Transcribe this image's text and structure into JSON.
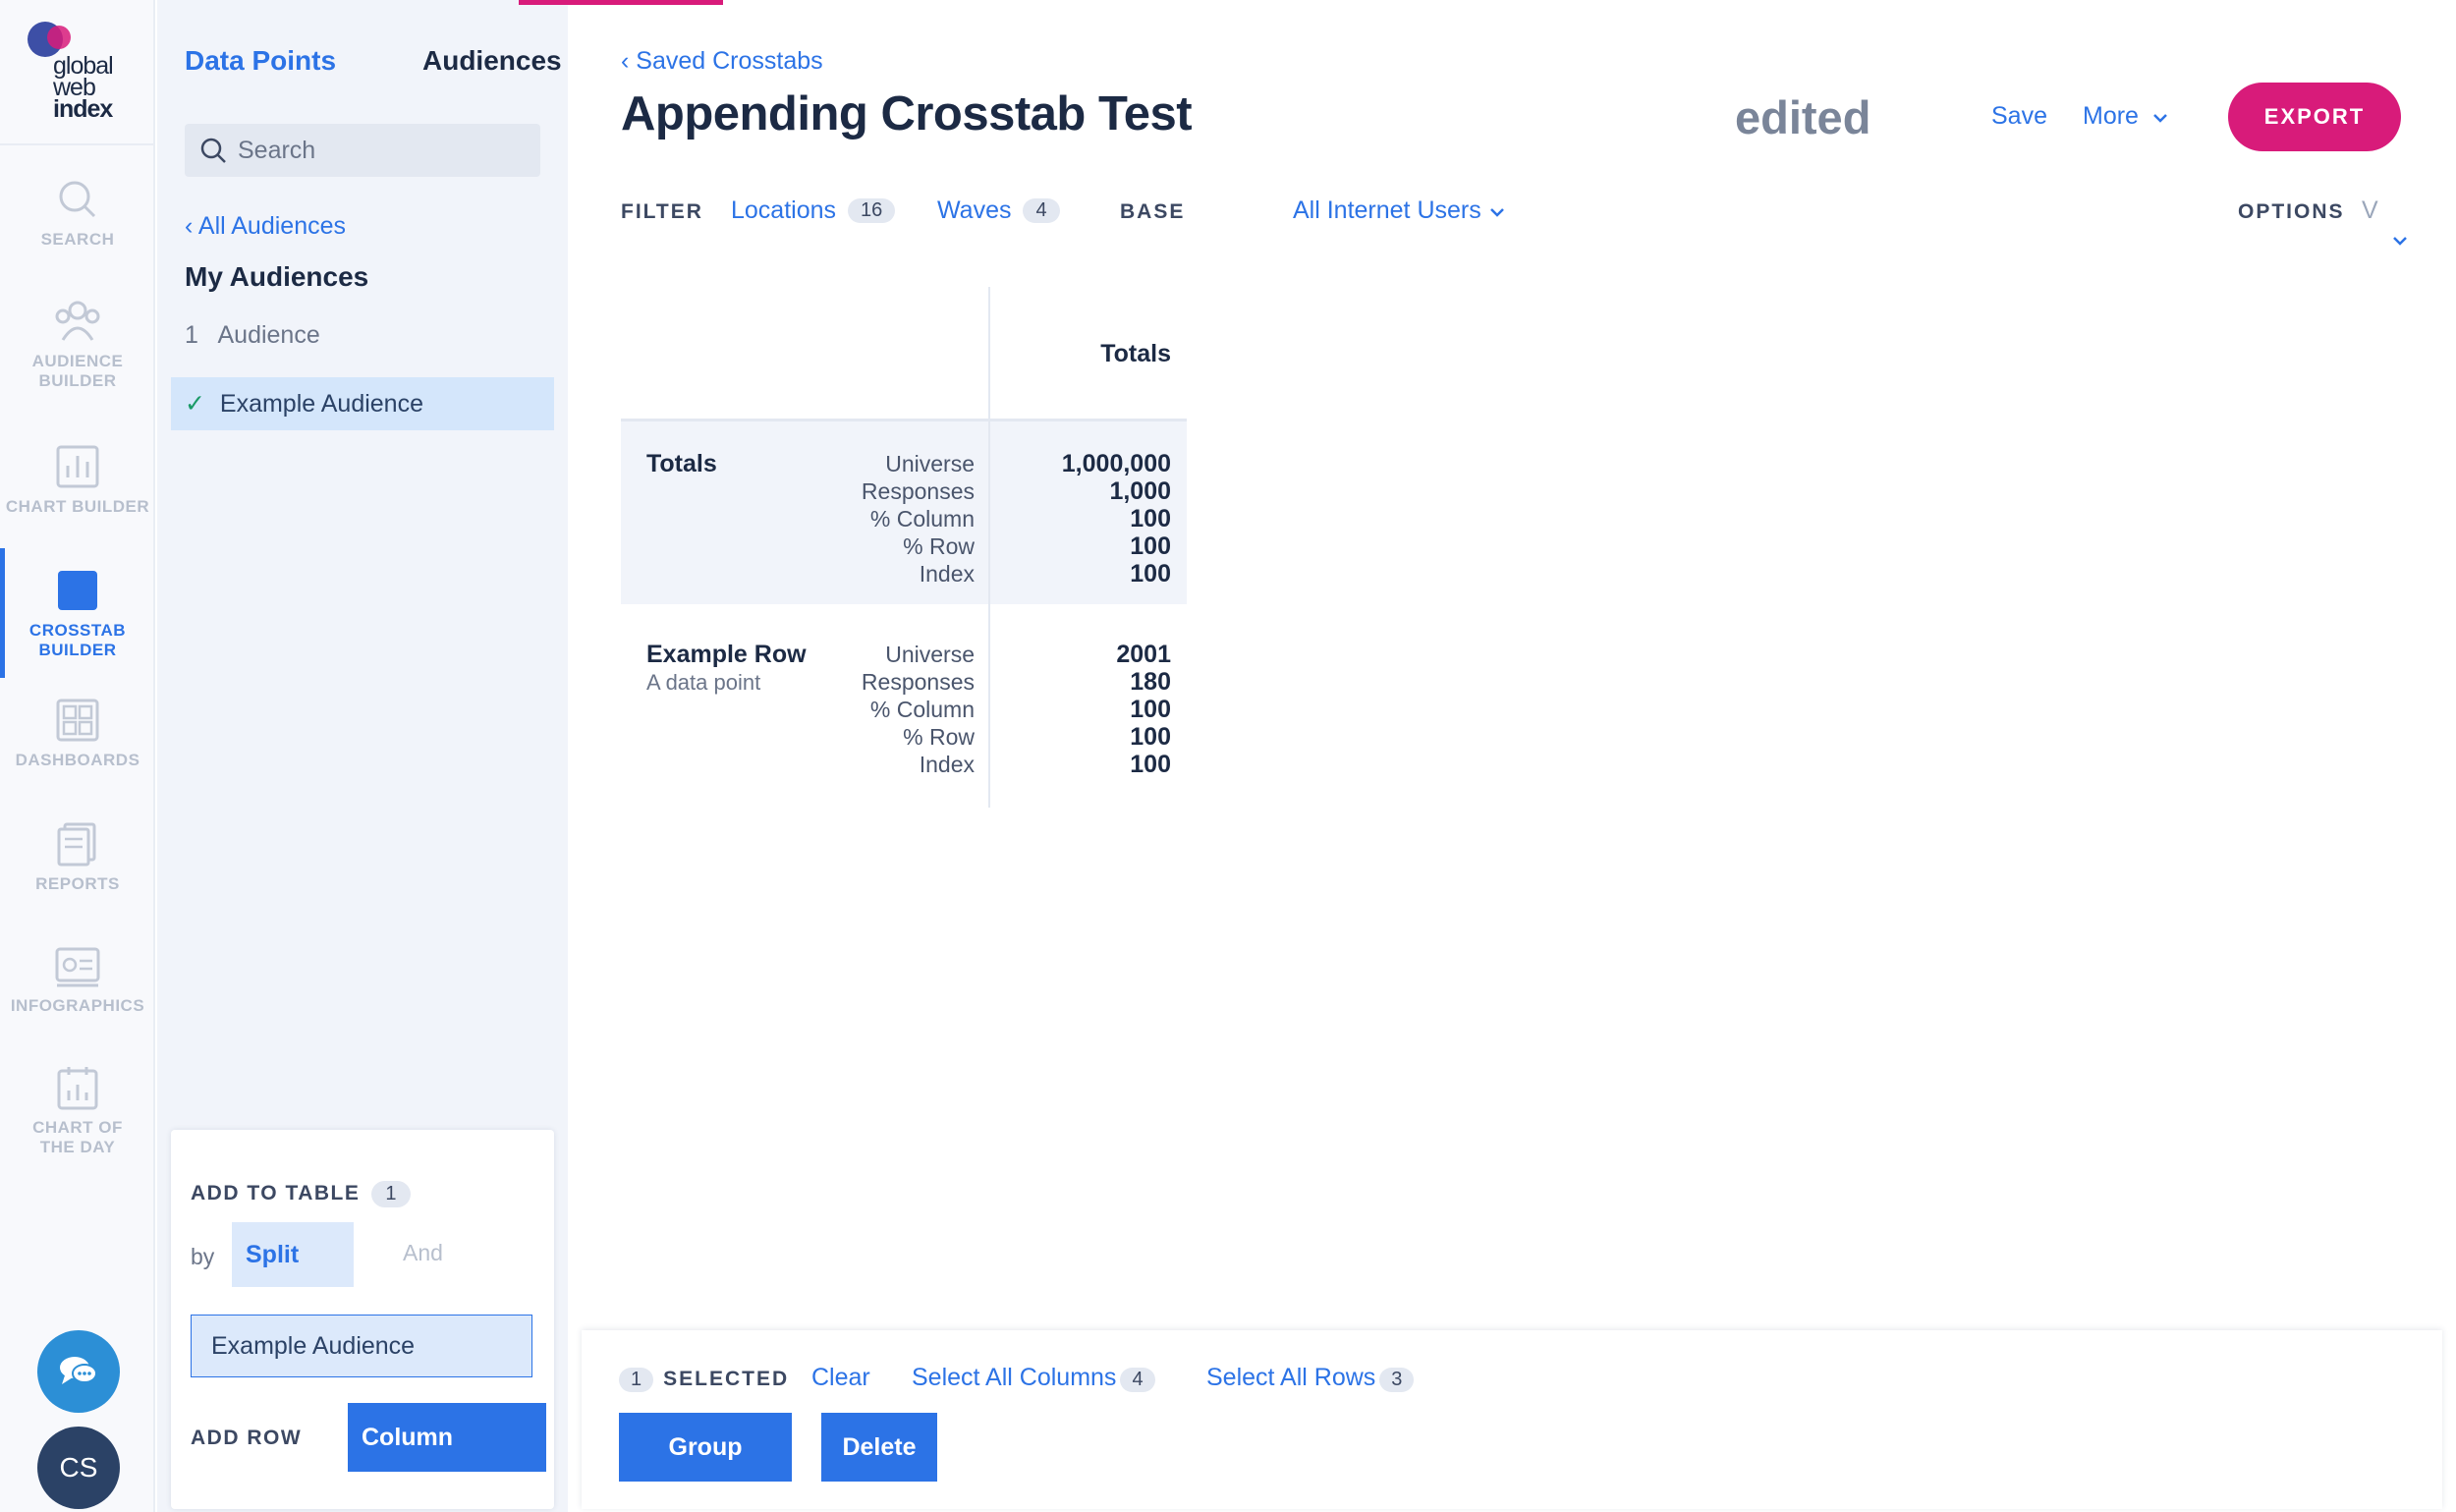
{
  "logo": {
    "line1": "global",
    "line2": "web",
    "line3": "index"
  },
  "nav": [
    {
      "label": "SEARCH",
      "icon": "search-icon"
    },
    {
      "label": "AUDIENCE",
      "label2": "BUILDER",
      "icon": "audience-icon"
    },
    {
      "label": "CHART BUILDER",
      "icon": "bar-chart-icon"
    },
    {
      "label": "CROSSTAB",
      "label2": "BUILDER",
      "icon": "crosstab-icon",
      "active": true
    },
    {
      "label": "DASHBOARDS",
      "icon": "dashboard-icon"
    },
    {
      "label": "REPORTS",
      "icon": "reports-icon"
    },
    {
      "label": "INFOGRAPHICS",
      "icon": "infographics-icon"
    },
    {
      "label": "CHART OF",
      "label2": "THE DAY",
      "icon": "calendar-chart-icon"
    }
  ],
  "user": {
    "initials": "CS"
  },
  "panel": {
    "tabs": [
      "Data Points",
      "Audiences"
    ],
    "search_placeholder": "Search",
    "back_link": "All Audiences",
    "section": "My Audiences",
    "audiences": [
      {
        "num": "1",
        "name": "Audience"
      },
      {
        "name": "Example Audience",
        "selected": true
      }
    ],
    "add_to_table": {
      "heading": "ADD TO TABLE",
      "count": "1",
      "by": "by",
      "split": "Split",
      "and": "And",
      "chip": "Example Audience",
      "add_as": "ADD ROW",
      "column_btn": "Column"
    }
  },
  "main": {
    "crumb": "Saved Crosstabs",
    "title": "Appending Crosstab Test",
    "edited": "edited",
    "save": "Save",
    "more": "More",
    "export": "EXPORT",
    "filter": {
      "label": "FILTER",
      "locations": "Locations",
      "locations_count": "16",
      "waves": "Waves",
      "waves_count": "4",
      "base_label": "BASE",
      "base_value": "All Internet Users",
      "options_label": "OPTIONS",
      "view": "V"
    },
    "crosstab": {
      "column_header": "Totals",
      "rows": [
        {
          "title": "Totals",
          "subtitle": "",
          "metrics": [
            "Universe",
            "Responses",
            "% Column",
            "% Row",
            "Index"
          ],
          "values": [
            "1,000,000",
            "1,000",
            "100",
            "100",
            "100"
          ]
        },
        {
          "title": "Example Row",
          "subtitle": "A data point",
          "metrics": [
            "Universe",
            "Responses",
            "% Column",
            "% Row",
            "Index"
          ],
          "values": [
            "2001",
            "180",
            "100",
            "100",
            "100"
          ]
        }
      ]
    },
    "selection": {
      "count": "1",
      "label": "SELECTED",
      "clear": "Clear",
      "select_columns": "Select All Columns",
      "columns_count": "4",
      "select_rows": "Select All Rows",
      "rows_count": "3",
      "group_btn": "Group",
      "delete_btn": "Delete"
    }
  },
  "colors": {
    "accent": "#2c73e6",
    "export": "#d81b7a",
    "panel_bg": "#f1f4fa",
    "selected_row": "#d4e6fb"
  }
}
